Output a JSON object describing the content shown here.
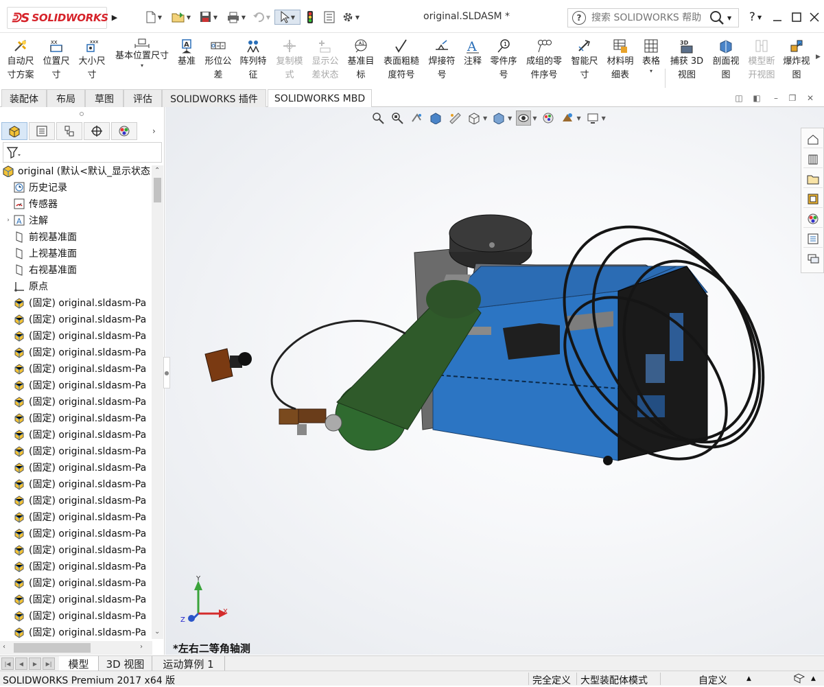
{
  "app": {
    "logo_text": "SOLIDWORKS",
    "document_title": "original.SLDASM *",
    "search_placeholder": "搜索 SOLIDWORKS 帮助",
    "help_label": "?"
  },
  "toolbar": {
    "tools": [
      {
        "id": "auto-dimension-scheme",
        "label": "自动尺\n寸方案",
        "enabled": true
      },
      {
        "id": "location-dimension",
        "label": "位置尺\n寸",
        "enabled": true
      },
      {
        "id": "size-dimension",
        "label": "大小尺\n寸",
        "enabled": true
      },
      {
        "id": "basic-location-dimension",
        "label": "基本位置尺寸",
        "enabled": true
      },
      {
        "id": "datum",
        "label": "基准",
        "enabled": true
      },
      {
        "id": "geometric-tolerance",
        "label": "形位公\n差",
        "enabled": true
      },
      {
        "id": "pattern-feature",
        "label": "阵列特\n征",
        "enabled": true
      },
      {
        "id": "copy-scheme",
        "label": "复制模\n式",
        "enabled": false
      },
      {
        "id": "show-tolerance-status",
        "label": "显示公\n差状态",
        "enabled": false
      },
      {
        "id": "datum-target",
        "label": "基准目\n标",
        "enabled": true
      },
      {
        "id": "surface-finish",
        "label": "表面粗糙\n度符号",
        "enabled": true
      },
      {
        "id": "weld-symbol",
        "label": "焊接符\n号",
        "enabled": true
      },
      {
        "id": "note",
        "label": "注释",
        "enabled": true
      },
      {
        "id": "balloon",
        "label": "零件序\n号",
        "enabled": true
      },
      {
        "id": "stacked-balloon",
        "label": "成组的零\n件序号",
        "enabled": true
      },
      {
        "id": "smart-dimension",
        "label": "智能尺\n寸",
        "enabled": true
      },
      {
        "id": "bom",
        "label": "材料明\n细表",
        "enabled": true
      },
      {
        "id": "table",
        "label": "表格",
        "enabled": true
      },
      {
        "id": "capture-3d-view",
        "label": "捕获 3D\n视图",
        "enabled": true
      },
      {
        "id": "section-view",
        "label": "剖面视\n图",
        "enabled": true
      },
      {
        "id": "model-break-view",
        "label": "模型断\n开视图",
        "enabled": false
      },
      {
        "id": "explode-view",
        "label": "爆炸视\n图",
        "enabled": true
      }
    ]
  },
  "tabs": [
    {
      "label": "装配体",
      "active": false
    },
    {
      "label": "布局",
      "active": false
    },
    {
      "label": "草图",
      "active": false
    },
    {
      "label": "评估",
      "active": false
    },
    {
      "label": "SOLIDWORKS 插件",
      "active": false
    },
    {
      "label": "SOLIDWORKS MBD",
      "active": true
    }
  ],
  "tree": {
    "root": "original  (默认<默认_显示状态",
    "items": [
      {
        "label": "历史记录",
        "icon": "history-icon",
        "expandable": false
      },
      {
        "label": "传感器",
        "icon": "sensor-icon",
        "expandable": false
      },
      {
        "label": "注解",
        "icon": "annotation-icon",
        "expandable": true
      },
      {
        "label": "前视基准面",
        "icon": "plane-icon",
        "expandable": false
      },
      {
        "label": "上视基准面",
        "icon": "plane-icon",
        "expandable": false
      },
      {
        "label": "右视基准面",
        "icon": "plane-icon",
        "expandable": false
      },
      {
        "label": "原点",
        "icon": "origin-icon",
        "expandable": false
      }
    ],
    "component_label": "(固定) original.sldasm-Pa",
    "component_count": 21
  },
  "viewport": {
    "view_name": "*左右二等角轴测",
    "triad": {
      "x": "X",
      "y": "Y",
      "z": "Z"
    }
  },
  "bottom_tabs": [
    {
      "label": "模型",
      "active": true
    },
    {
      "label": "3D 视图",
      "active": false
    },
    {
      "label": "运动算例 1",
      "active": false
    }
  ],
  "status": {
    "product": "SOLIDWORKS Premium 2017 x64 版",
    "definition": "完全定义",
    "mode": "大型装配体模式",
    "units": "自定义"
  },
  "colors": {
    "accent_red": "#d6232a",
    "machine_blue": "#1f6dbd",
    "cylinder_green": "#2f5a2a"
  }
}
